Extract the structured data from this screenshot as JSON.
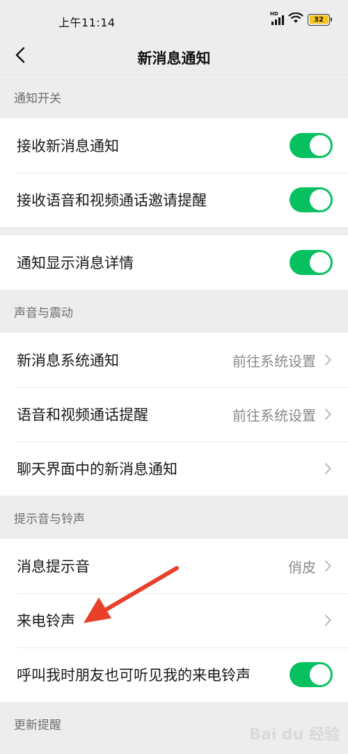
{
  "status_bar": {
    "time": "上午11:14",
    "network": "HD",
    "battery": "32",
    "icons": [
      "signal-icon",
      "wifi-icon",
      "battery-icon"
    ]
  },
  "nav": {
    "title": "新消息通知",
    "back_icon": "chevron-left-icon"
  },
  "sections": {
    "notify": {
      "header": "通知开关",
      "rows": [
        {
          "label": "接收新消息通知",
          "toggle": true
        },
        {
          "label": "接收语音和视频通话邀请提醒",
          "toggle": true
        }
      ]
    },
    "detail": {
      "rows": [
        {
          "label": "通知显示消息详情",
          "toggle": true
        }
      ]
    },
    "sound": {
      "header": "声音与震动",
      "rows": [
        {
          "label": "新消息系统通知",
          "value": "前往系统设置"
        },
        {
          "label": "语音和视频通话提醒",
          "value": "前往系统设置"
        },
        {
          "label": "聊天界面中的新消息通知",
          "value": ""
        }
      ]
    },
    "ringtone": {
      "header": "提示音与铃声",
      "rows": [
        {
          "label": "消息提示音",
          "value": "俏皮"
        },
        {
          "label": "来电铃声",
          "value": ""
        },
        {
          "label": "呼叫我时朋友也可听见我的来电铃声",
          "toggle": true
        }
      ]
    },
    "update": {
      "header": "更新提醒"
    }
  },
  "colors": {
    "toggle_on": "#07c160",
    "background": "#ededed",
    "annotation_arrow": "#e8402a"
  },
  "watermark": {
    "text": "Bai du 经验"
  }
}
